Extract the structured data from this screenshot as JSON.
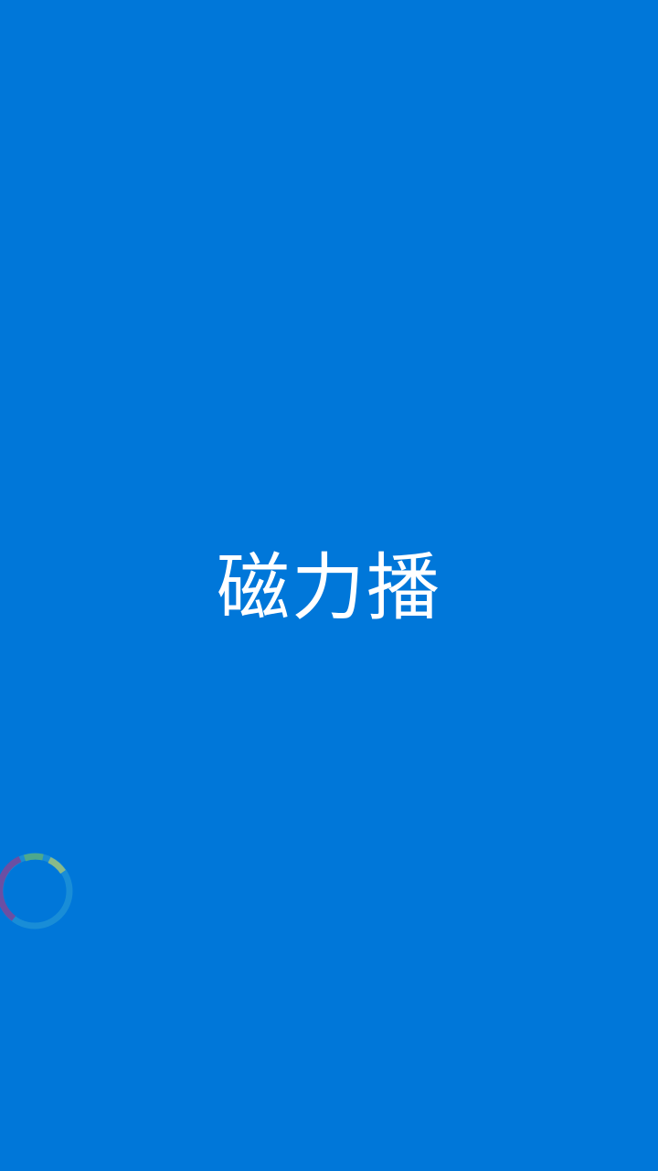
{
  "splash": {
    "background_color": "#0077d9",
    "app_title": "磁力播"
  },
  "floating_widget": {
    "icon": "loading-ring-icon",
    "ring_colors": [
      "#6b4fa3",
      "#4ea88c",
      "#8aba8a",
      "#1c8fd6"
    ]
  }
}
